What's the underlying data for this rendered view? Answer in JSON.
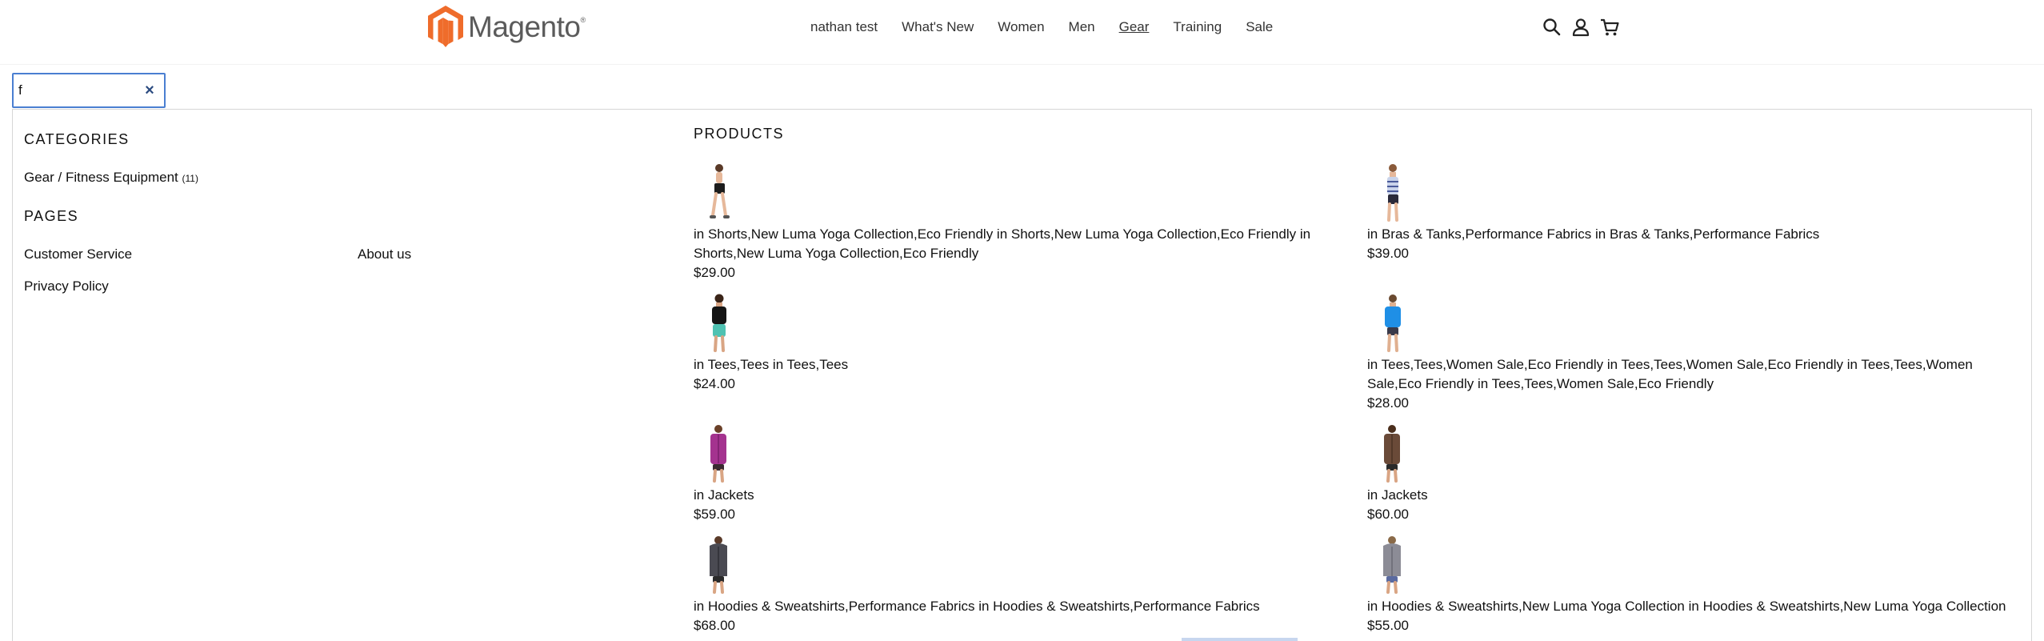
{
  "brand": {
    "name": "Magento",
    "trademark": "®",
    "color": "#ef6c2b"
  },
  "nav": {
    "items": [
      "nathan test",
      "What's New",
      "Women",
      "Men",
      "Gear",
      "Training",
      "Sale"
    ],
    "active": "Gear"
  },
  "header_icons": [
    "search-icon",
    "account-icon",
    "cart-icon"
  ],
  "search": {
    "value": "f"
  },
  "categories": {
    "title": "CATEGORIES",
    "items": [
      {
        "label": "Gear / Fitness Equipment",
        "count": "(11)"
      }
    ]
  },
  "pages": {
    "title": "PAGES",
    "items": [
      "Customer Service",
      "About us",
      "Privacy Policy"
    ]
  },
  "products": {
    "title": "PRODUCTS",
    "items": [
      {
        "desc": "in Shorts,New Luma Yoga Collection,Eco Friendly in Shorts,New Luma Yoga Collection,Eco Friendly in Shorts,New Luma Yoga Collection,Eco Friendly",
        "price": "$29.00",
        "image": "woman-in-shorts"
      },
      {
        "desc": "in Bras & Tanks,Performance Fabrics in Bras & Tanks,Performance Fabrics",
        "price": "$39.00",
        "image": "woman-in-striped-tank"
      },
      {
        "desc": "in Tees,Tees in Tees,Tees",
        "price": "$24.00",
        "image": "woman-in-black-tee"
      },
      {
        "desc": "in Tees,Tees,Women Sale,Eco Friendly in Tees,Tees,Women Sale,Eco Friendly in Tees,Tees,Women Sale,Eco Friendly in Tees,Tees,Women Sale,Eco Friendly",
        "price": "$28.00",
        "image": "woman-in-blue-tee"
      },
      {
        "desc": "in Jackets",
        "price": "$59.00",
        "image": "woman-in-purple-jacket"
      },
      {
        "desc": "in Jackets",
        "price": "$60.00",
        "image": "woman-in-brown-jacket"
      },
      {
        "desc": "in Hoodies & Sweatshirts,Performance Fabrics in Hoodies & Sweatshirts,Performance Fabrics",
        "price": "$68.00",
        "image": "woman-in-dark-hoodie"
      },
      {
        "desc": "in Hoodies & Sweatshirts,New Luma Yoga Collection in Hoodies & Sweatshirts,New Luma Yoga Collection",
        "price": "$55.00",
        "image": "woman-in-grey-hoodie"
      }
    ]
  },
  "colors": {
    "accent_border": "#4a7fd1",
    "text": "#111111",
    "nav_text": "#333333"
  }
}
